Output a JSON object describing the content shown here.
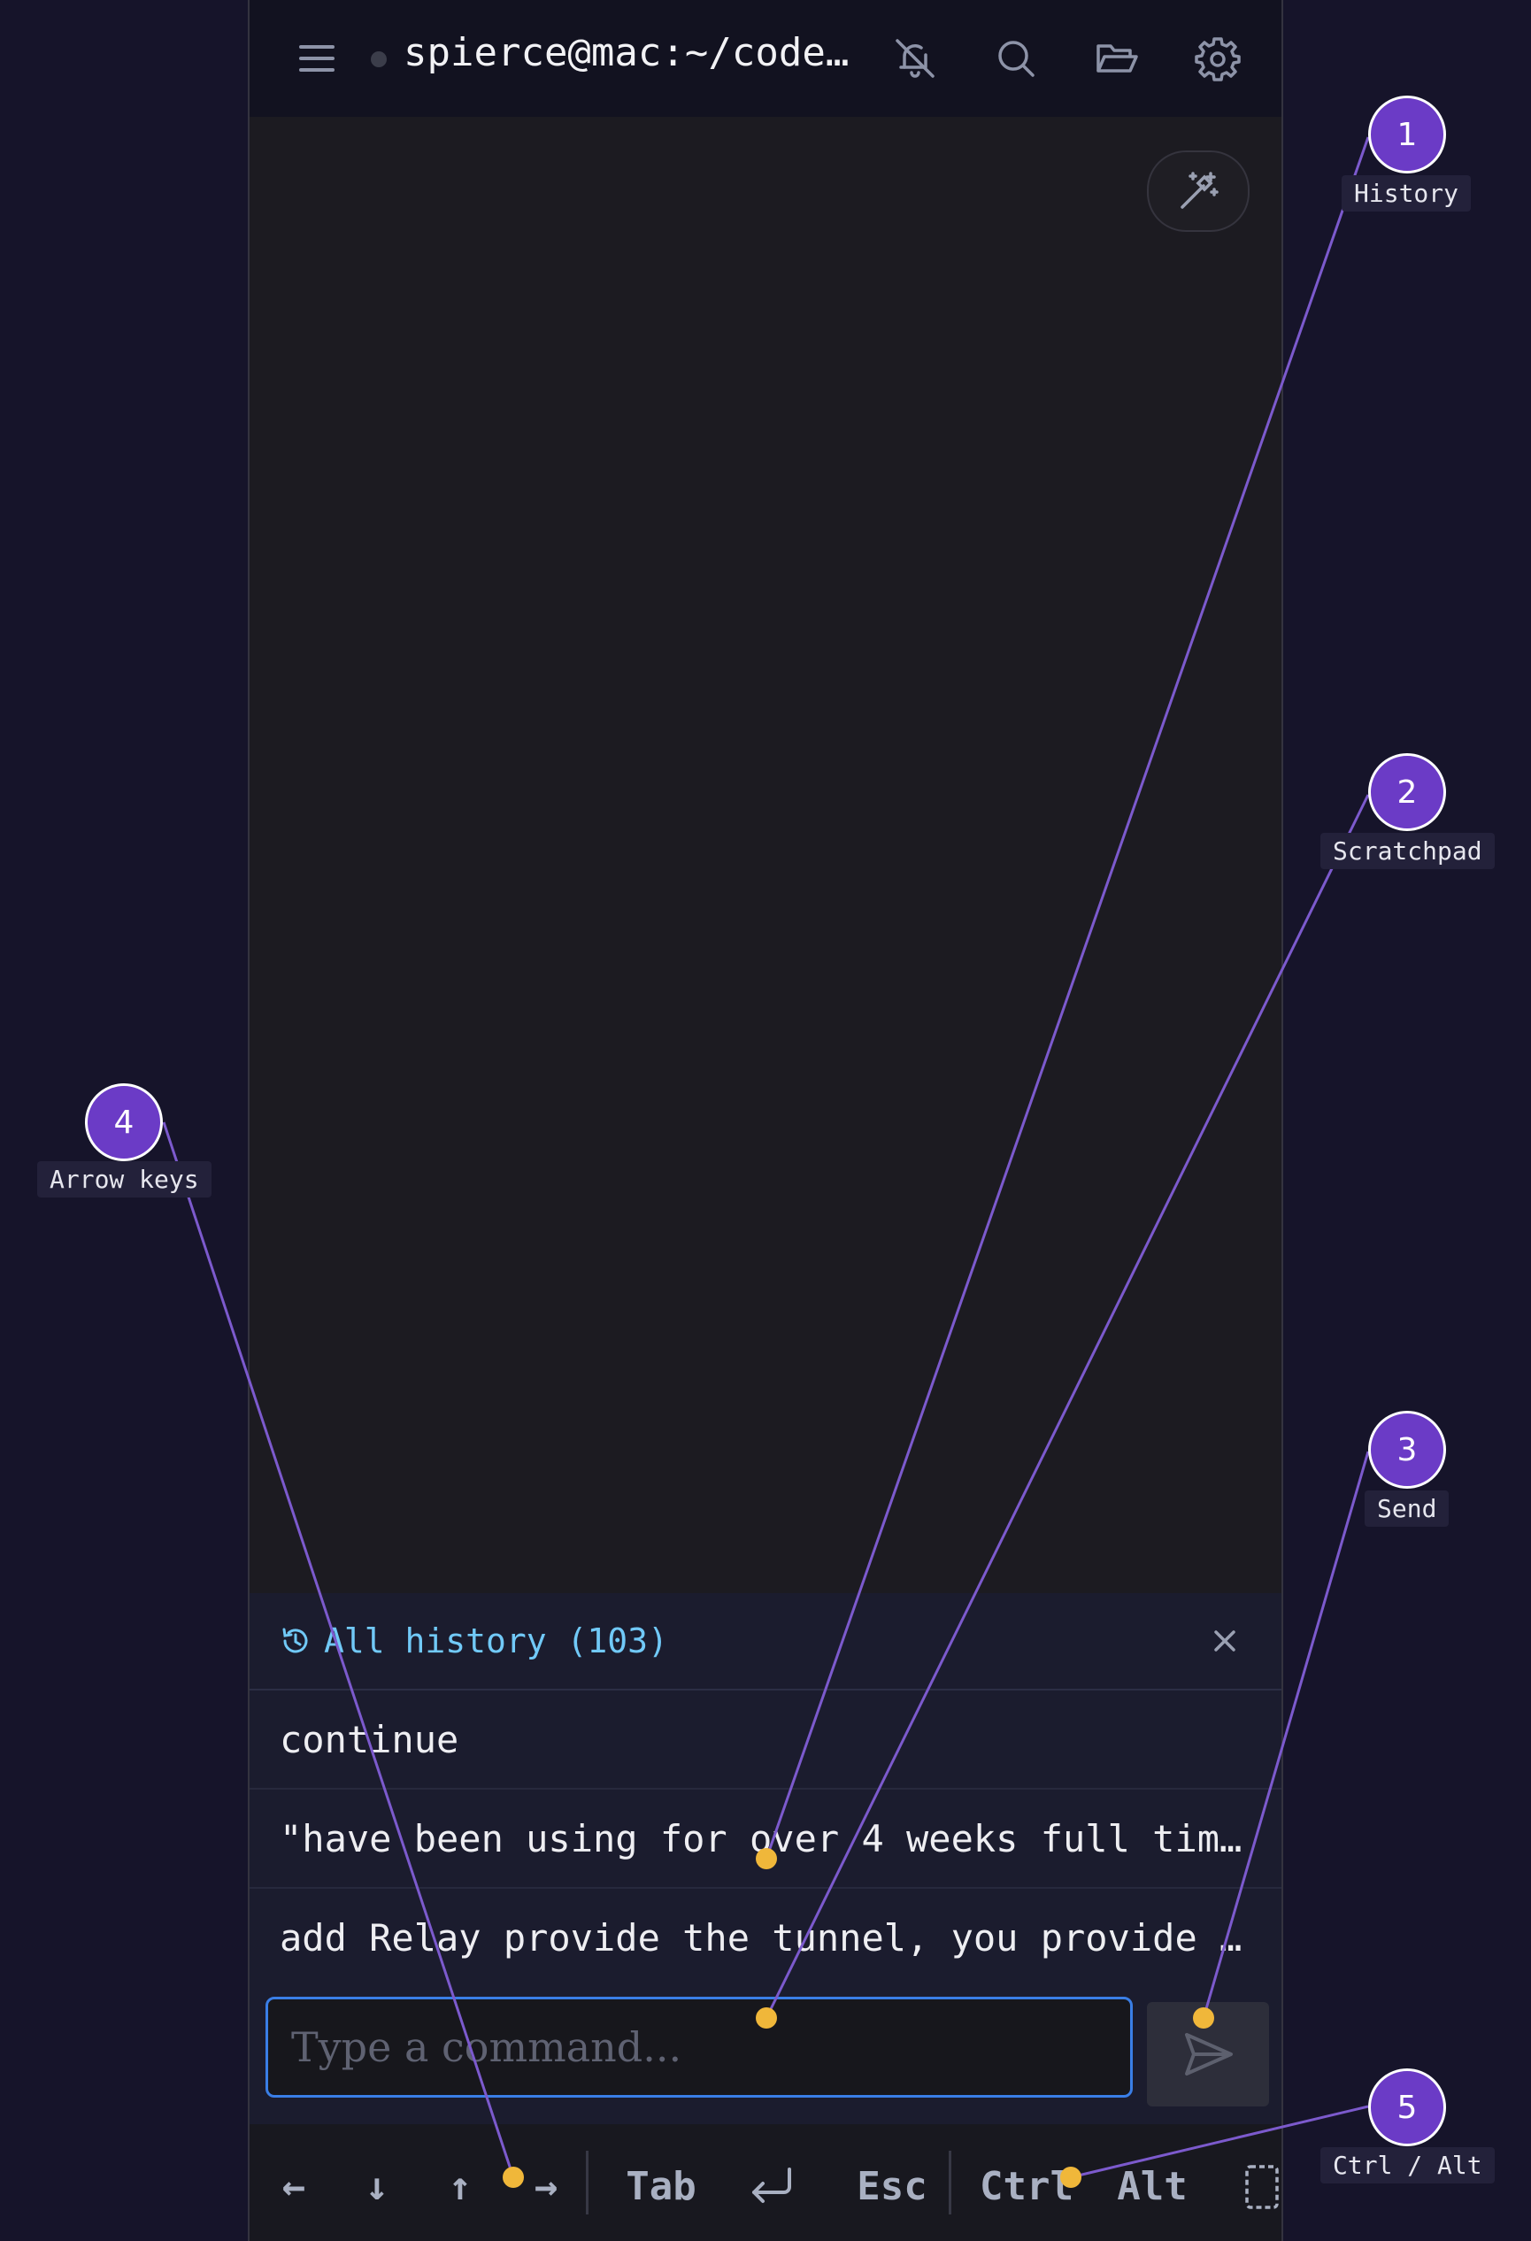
{
  "header": {
    "title": "spierce@mac:~/code…",
    "menu_icon": "hamburger-menu-icon",
    "icons": [
      "bell-off-icon",
      "search-icon",
      "folder-open-icon",
      "gear-icon"
    ]
  },
  "terminal": {
    "magic_icon": "magic-wand-icon"
  },
  "history": {
    "title": "All history (103)",
    "icon": "history-icon",
    "close_icon": "close-icon",
    "items": [
      "continue",
      "\"have been using for over 4 weeks full tim…",
      "add Relay provide the tunnel, you provide …"
    ]
  },
  "input": {
    "placeholder": "Type a command...",
    "send_icon": "send-icon"
  },
  "keybar": {
    "keys": [
      "←",
      "↓",
      "↑",
      "→",
      "Tab",
      "⏎",
      "Esc",
      "Ctrl",
      "Alt"
    ]
  },
  "annotations": [
    {
      "number": "1",
      "label": "History"
    },
    {
      "number": "2",
      "label": "Scratchpad"
    },
    {
      "number": "3",
      "label": "Send"
    },
    {
      "number": "4",
      "label": "Arrow keys"
    },
    {
      "number": "5",
      "label": "Ctrl / Alt"
    }
  ],
  "colors": {
    "background": "#16142a",
    "accent_purple": "#6b3bc6",
    "marker_yellow": "#f0b73a",
    "history_title": "#71c9f7",
    "input_border": "#3a7ee6"
  }
}
